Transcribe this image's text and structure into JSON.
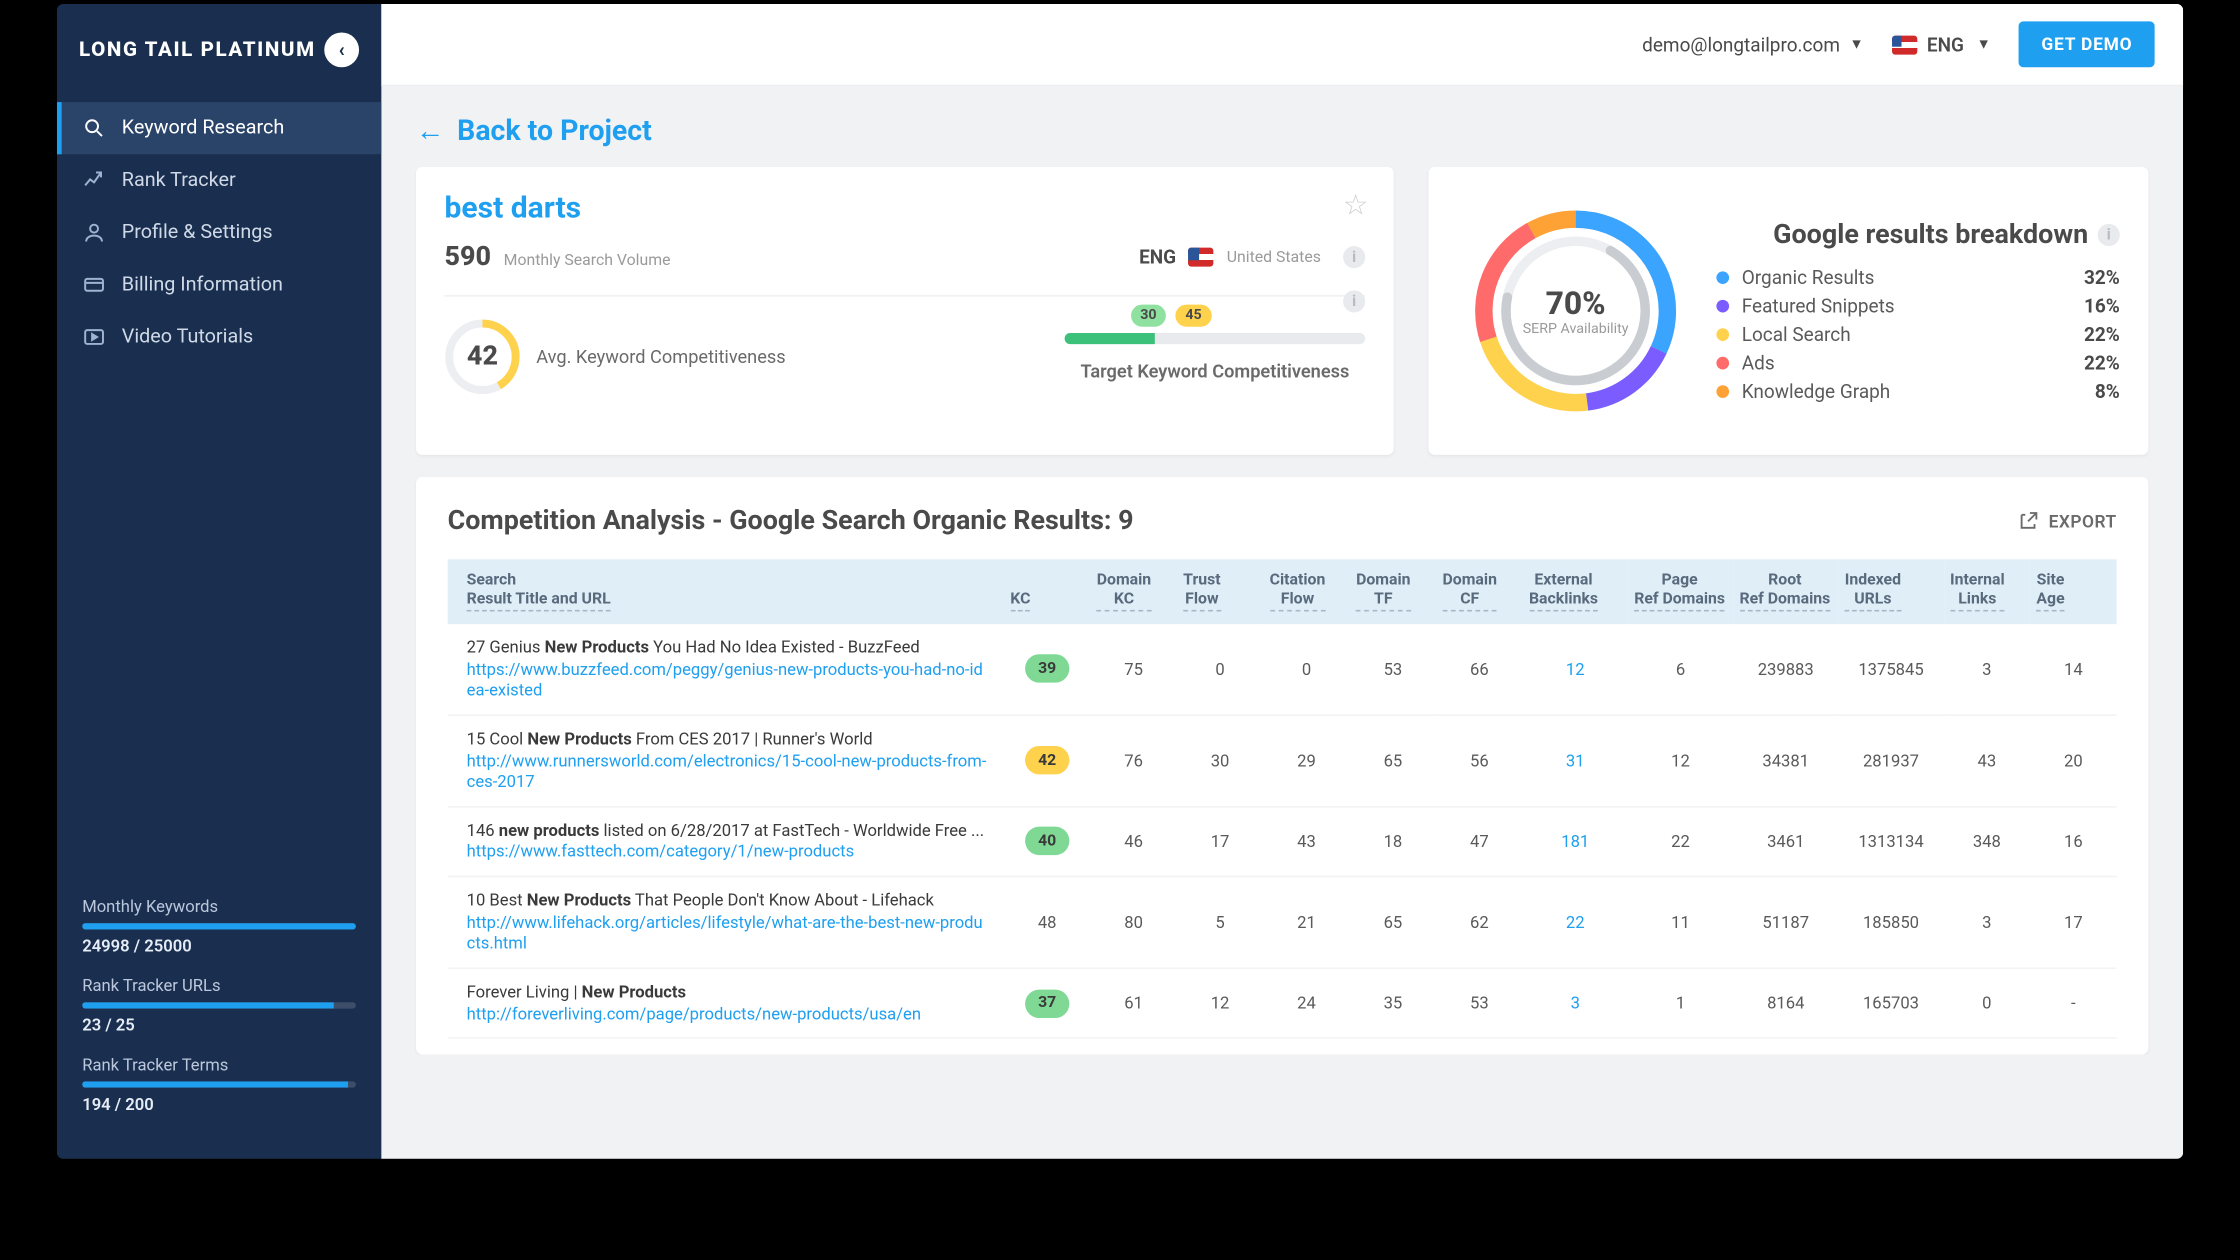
{
  "brand": "LONG TAIL PLATINUM",
  "sidebar": {
    "items": [
      {
        "icon": "search",
        "label": "Keyword Research",
        "active": true
      },
      {
        "icon": "trend",
        "label": "Rank Tracker"
      },
      {
        "icon": "user",
        "label": "Profile & Settings"
      },
      {
        "icon": "card",
        "label": "Billing Information"
      },
      {
        "icon": "play",
        "label": "Video Tutorials"
      }
    ],
    "quotas": [
      {
        "label": "Monthly Keywords",
        "value": "24998 / 25000",
        "pct": 99.99
      },
      {
        "label": "Rank Tracker URLs",
        "value": "23 / 25",
        "pct": 92
      },
      {
        "label": "Rank Tracker Terms",
        "value": "194 / 200",
        "pct": 97
      }
    ]
  },
  "topbar": {
    "email": "demo@longtailpro.com",
    "lang": "ENG",
    "cta": "GET DEMO"
  },
  "backlink": "Back to Project",
  "keyword": {
    "title": "best darts",
    "msv": "590",
    "msv_label": "Monthly Search Volume",
    "lang": "ENG",
    "country": "United States",
    "kc": "42",
    "kc_label": "Avg. Keyword Competitiveness",
    "range_low": "30",
    "range_high": "45",
    "tkc_label": "Target Keyword Competitiveness"
  },
  "breakdown": {
    "title": "Google results breakdown",
    "center_pct": "70%",
    "center_label": "SERP Availability",
    "items": [
      {
        "label": "Organic Results",
        "pct": "32%",
        "color": "#3aa4ff"
      },
      {
        "label": "Featured Snippets",
        "pct": "16%",
        "color": "#7a5cff"
      },
      {
        "label": "Local Search",
        "pct": "22%",
        "color": "#ffd24d"
      },
      {
        "label": "Ads",
        "pct": "22%",
        "color": "#ff6b6b"
      },
      {
        "label": "Knowledge Graph",
        "pct": "8%",
        "color": "#ffa235"
      }
    ]
  },
  "chart_data": {
    "type": "pie",
    "title": "Google results breakdown",
    "series": [
      {
        "name": "SERP share",
        "values": [
          32,
          16,
          22,
          22,
          8
        ]
      }
    ],
    "categories": [
      "Organic Results",
      "Featured Snippets",
      "Local Search",
      "Ads",
      "Knowledge Graph"
    ],
    "center_value": 70,
    "center_label": "SERP Availability"
  },
  "table": {
    "title": "Competition Analysis - Google Search Organic Results: 9",
    "export": "EXPORT",
    "headers": [
      "Search Result Title and URL",
      "KC",
      "Domain KC",
      "Trust Flow",
      "Citation Flow",
      "Domain TF",
      "Domain CF",
      "External Backlinks",
      "Page Ref Domains",
      "Root Ref Domains",
      "Indexed URLs",
      "Internal Links",
      "Site Age"
    ],
    "rows": [
      {
        "title": "27 Genius New Products You Had No Idea Existed - BuzzFeed",
        "url": "https://www.buzzfeed.com/peggy/genius-new-products-you-had-no-idea-existed",
        "kc": "39",
        "kc_class": "g",
        "dkc": "75",
        "tf": "0",
        "cf": "0",
        "dtf": "53",
        "dcf": "66",
        "eb": "12",
        "prd": "6",
        "rrd": "239883",
        "iu": "1375845",
        "il": "3",
        "age": "14"
      },
      {
        "title": "15 Cool New Products From CES 2017 | Runner's World",
        "url": "http://www.runnersworld.com/electronics/15-cool-new-products-from-ces-2017",
        "kc": "42",
        "kc_class": "y",
        "dkc": "76",
        "tf": "30",
        "cf": "29",
        "dtf": "65",
        "dcf": "56",
        "eb": "31",
        "prd": "12",
        "rrd": "34381",
        "iu": "281937",
        "il": "43",
        "age": "20"
      },
      {
        "title": "146 new products listed on 6/28/2017 at FastTech - Worldwide Free ...",
        "url": "https://www.fasttech.com/category/1/new-products",
        "kc": "40",
        "kc_class": "g",
        "dkc": "46",
        "tf": "17",
        "cf": "43",
        "dtf": "18",
        "dcf": "47",
        "eb": "181",
        "prd": "22",
        "rrd": "3461",
        "iu": "1313134",
        "il": "348",
        "age": "16"
      },
      {
        "title": "10 Best New Products That People Don't Know About - Lifehack",
        "url": "http://www.lifehack.org/articles/lifestyle/what-are-the-best-new-products.html",
        "kc": "48",
        "kc_class": "",
        "dkc": "80",
        "tf": "5",
        "cf": "21",
        "dtf": "65",
        "dcf": "62",
        "eb": "22",
        "prd": "11",
        "rrd": "51187",
        "iu": "185850",
        "il": "3",
        "age": "17"
      },
      {
        "title": "Forever Living | New Products",
        "url": "http://foreverliving.com/page/products/new-products/usa/en",
        "kc": "37",
        "kc_class": "g",
        "dkc": "61",
        "tf": "12",
        "cf": "24",
        "dtf": "35",
        "dcf": "53",
        "eb": "3",
        "prd": "1",
        "rrd": "8164",
        "iu": "165703",
        "il": "0",
        "age": "-"
      }
    ]
  }
}
